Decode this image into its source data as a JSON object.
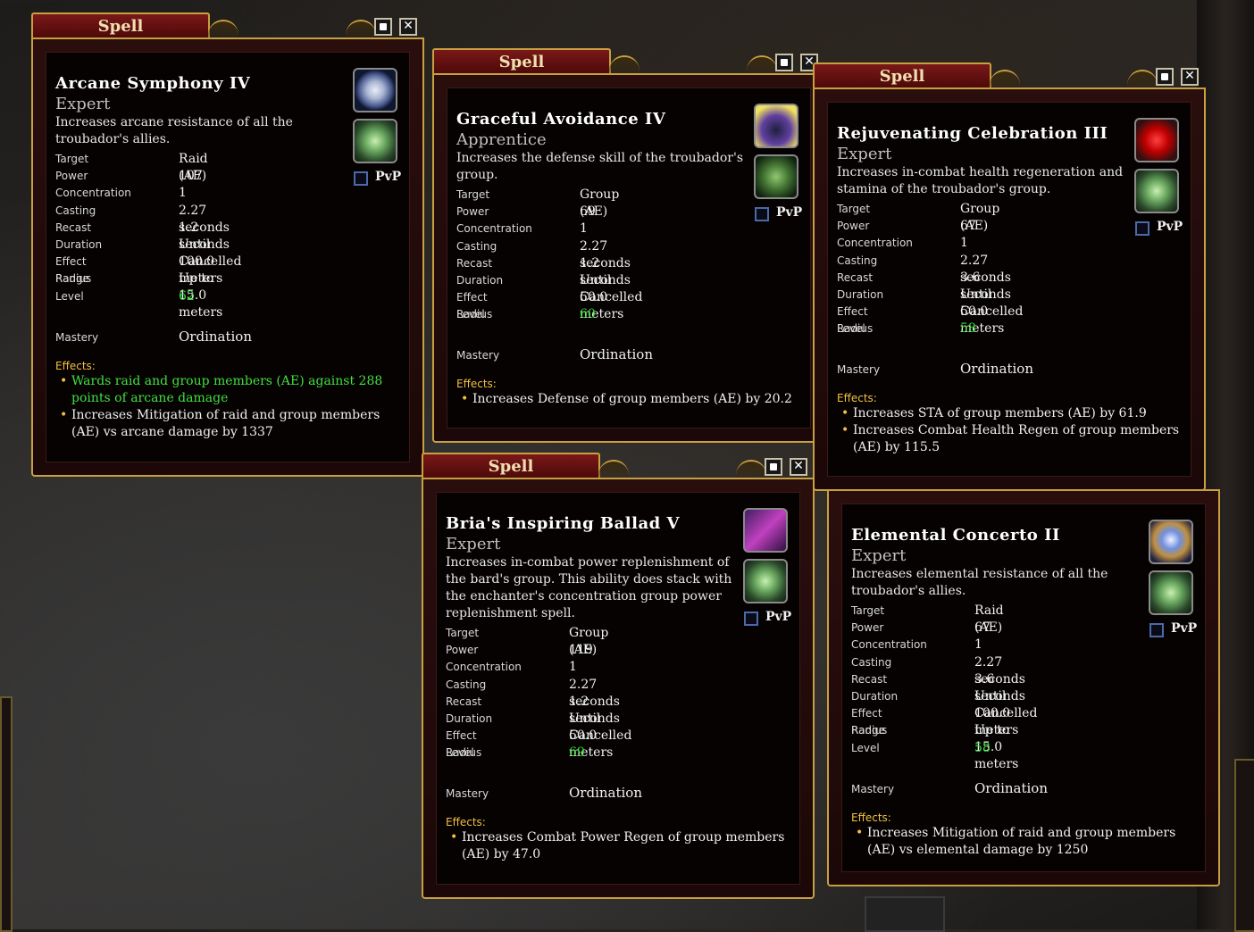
{
  "window_title": "Spell",
  "pvp_label": "PvP",
  "close_glyph": "✕",
  "labels": {
    "target": "Target",
    "power": "Power",
    "concentration": "Concentration",
    "casting": "Casting",
    "recast": "Recast",
    "duration": "Duration",
    "effect_radius": "Effect Radius",
    "range": "Range",
    "level": "Level",
    "mastery": "Mastery",
    "effects": "Effects:"
  },
  "colors": {
    "gold_border": "#c8a040",
    "title_red": "#7a1818",
    "level_green": "#33e033",
    "highlight_green": "#40e040",
    "bullet_gold": "#f0c040"
  },
  "spells": [
    {
      "name": "Arcane Symphony IV",
      "rank": "Expert",
      "description": [
        "Increases arcane resistance of all the",
        "troubador's allies."
      ],
      "icon1": "moon-icon",
      "icon2": "green-rune-icon",
      "target": "Raid (AE)",
      "power": "107",
      "concentration": "1",
      "casting": "2.27 seconds",
      "recast": "1.2 seconds",
      "duration": "Until Cancelled",
      "effect_radius": "100.0 meters",
      "range": "Up to 15.0 meters",
      "level": "62",
      "mastery": "Ordination",
      "effects": [
        [
          "Wards raid and group members (AE) against 288",
          "points of arcane damage"
        ],
        [
          "Increases Mitigation of raid and group members",
          "(AE) vs arcane damage by 1337"
        ]
      ]
    },
    {
      "name": "Graceful Avoidance IV",
      "rank": "Apprentice",
      "description": [
        "Increases the defense skill of the troubador's",
        "group."
      ],
      "icon1": "silhouette-icon",
      "icon2": "cloak-icon",
      "target": "Group (AE)",
      "power": "69",
      "concentration": "1",
      "casting": "2.27 seconds",
      "recast": "1.2 seconds",
      "duration": "Until Cancelled",
      "effect_radius": "50.0 meters",
      "level": "60",
      "mastery": "Ordination",
      "effects": [
        [
          "Increases Defense of group members (AE) by 20.2"
        ]
      ]
    },
    {
      "name": "Rejuvenating Celebration III",
      "rank": "Expert",
      "description": [
        "Increases in-combat health regeneration and",
        "stamina of the troubador's group."
      ],
      "icon1": "heart-icon",
      "icon2": "green-rune-icon",
      "target": "Group (AE)",
      "power": "67",
      "concentration": "1",
      "casting": "2.27 seconds",
      "recast": "3.6 seconds",
      "duration": "Until Cancelled",
      "effect_radius": "50.0 meters",
      "level": "58",
      "mastery": "Ordination",
      "effects": [
        [
          "Increases STA of group members (AE) by 61.9"
        ],
        [
          "Increases Combat Health Regen of group members",
          "(AE) by 115.5"
        ]
      ]
    },
    {
      "name": "Bria's Inspiring Ballad V",
      "rank": "Expert",
      "description": [
        "Increases in-combat power replenishment of",
        "the bard's group. This ability does stack with",
        "the enchanter's concentration group power",
        "replenishment spell."
      ],
      "icon1": "music-notes-icon",
      "icon2": "green-orb-icon",
      "target": "Group (AE)",
      "power": "119",
      "concentration": "1",
      "casting": "2.27 seconds",
      "recast": "1.2 seconds",
      "duration": "Until Cancelled",
      "effect_radius": "50.0 meters",
      "level": "69",
      "mastery": "Ordination",
      "effects": [
        [
          "Increases Combat Power Regen of group members",
          "(AE) by 47.0"
        ]
      ]
    },
    {
      "name": "Elemental Concerto II",
      "rank": "Expert",
      "description": [
        "Increases elemental resistance of all the",
        "troubador's allies."
      ],
      "icon1": "shield-icon",
      "icon2": "green-rune-icon",
      "target": "Raid (AE)",
      "power": "67",
      "concentration": "1",
      "casting": "2.27 seconds",
      "recast": "3.6 seconds",
      "duration": "Until Cancelled",
      "effect_radius": "100.0 meters",
      "range": "Up to 15.0 meters",
      "level": "58",
      "mastery": "Ordination",
      "effects": [
        [
          "Increases Mitigation of raid and group members",
          "(AE) vs elemental damage by 1250"
        ]
      ]
    }
  ]
}
